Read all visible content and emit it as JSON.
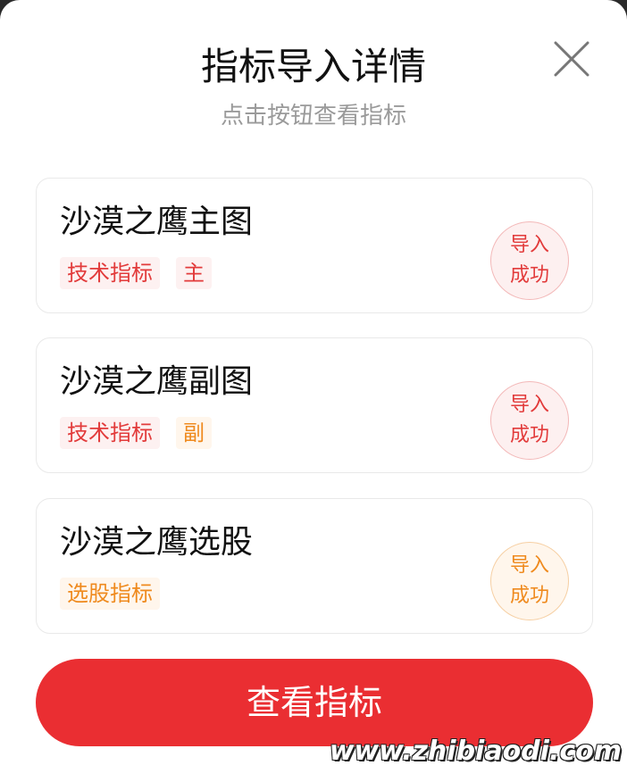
{
  "dialog": {
    "title": "指标导入详情",
    "subtitle": "点击按钮查看指标",
    "close_icon": "close-x-icon"
  },
  "cards": [
    {
      "name": "沙漠之鹰主图",
      "tags": [
        {
          "label": "技术指标",
          "tone": "red"
        },
        {
          "label": "主",
          "tone": "red"
        }
      ],
      "stamp": {
        "line1": "导入",
        "line2": "成功",
        "tone": "red"
      }
    },
    {
      "name": "沙漠之鹰副图",
      "tags": [
        {
          "label": "技术指标",
          "tone": "red"
        },
        {
          "label": "副",
          "tone": "orange"
        }
      ],
      "stamp": {
        "line1": "导入",
        "line2": "成功",
        "tone": "red"
      }
    },
    {
      "name": "沙漠之鹰选股",
      "tags": [
        {
          "label": "选股指标",
          "tone": "orange"
        }
      ],
      "stamp": {
        "line1": "导入",
        "line2": "成功",
        "tone": "orange"
      }
    }
  ],
  "cta": {
    "label": "查看指标"
  },
  "watermark": "www.zhibiaodi.com",
  "colors": {
    "accent_red": "#ea2e32",
    "tag_red": "#e23b3b",
    "tag_orange": "#ef8a1e"
  }
}
